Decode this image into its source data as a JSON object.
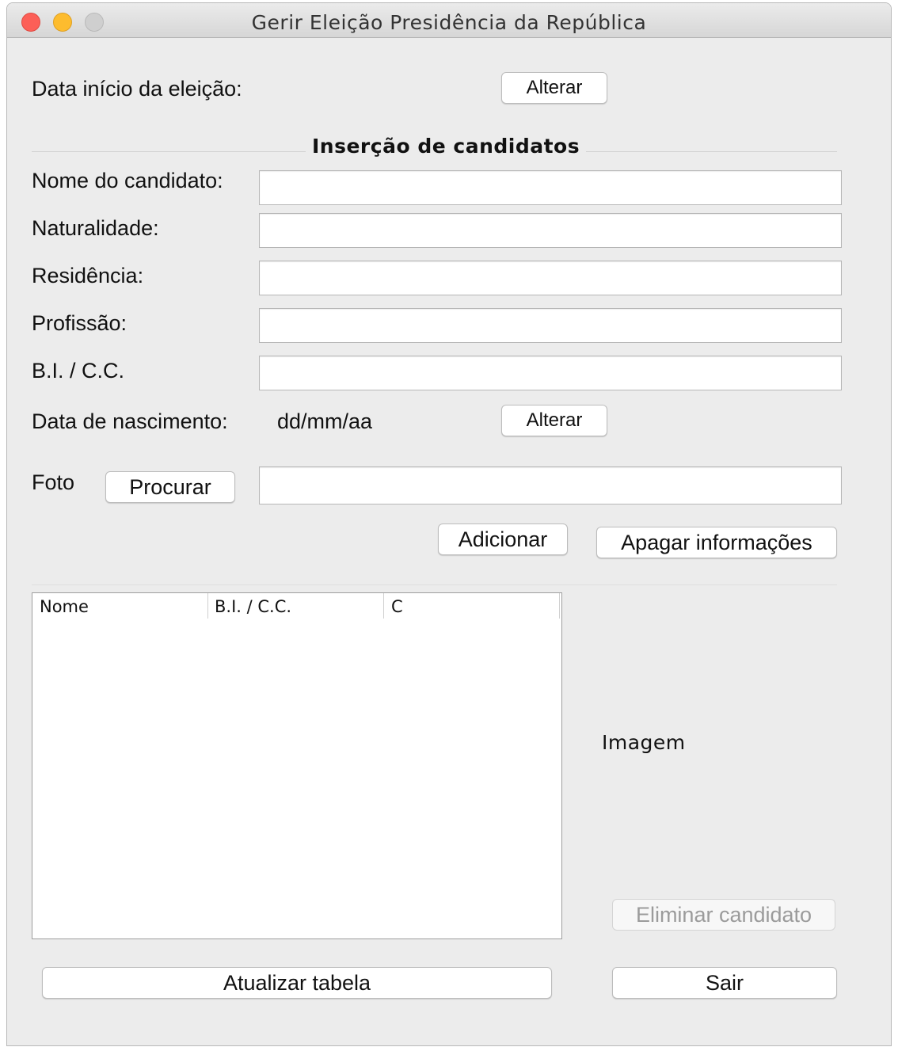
{
  "window": {
    "title": "Gerir Eleição Presidência da República"
  },
  "election": {
    "start_label": "Data início da eleição:",
    "change_button": "Alterar"
  },
  "candidate_section": {
    "title": "Inserção de candidatos",
    "fields": [
      {
        "label": "Nome do candidato:",
        "value": ""
      },
      {
        "label": "Naturalidade:",
        "value": ""
      },
      {
        "label": "Residência:",
        "value": ""
      },
      {
        "label": "Profissão:",
        "value": ""
      },
      {
        "label": "B.I. / C.C.",
        "value": ""
      }
    ],
    "birthdate_label": "Data de nascimento:",
    "birthdate_value": "dd/mm/aa",
    "birthdate_change_button": "Alterar",
    "photo_label": "Foto",
    "photo_browse_button": "Procurar",
    "photo_path_value": "",
    "add_button": "Adicionar",
    "clear_button": "Apagar informações"
  },
  "table": {
    "columns": [
      "Nome",
      "B.I. / C.C.",
      "C"
    ],
    "rows": []
  },
  "image_panel": {
    "placeholder": "Imagem",
    "delete_button": "Eliminar candidato"
  },
  "footer": {
    "refresh_button": "Atualizar tabela",
    "exit_button": "Sair"
  }
}
